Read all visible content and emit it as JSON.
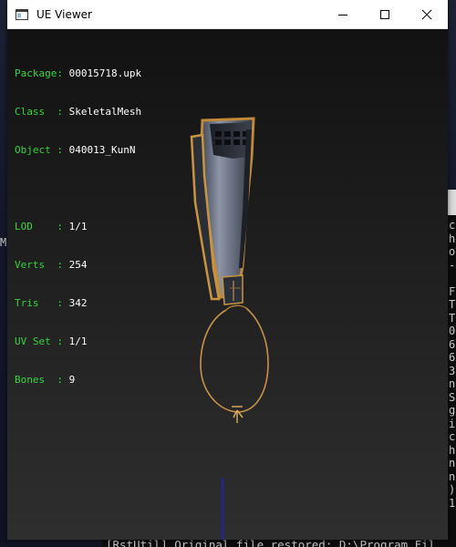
{
  "window": {
    "title": "UE Viewer"
  },
  "info": {
    "package": {
      "label": "Package:",
      "value": "00015718.upk"
    },
    "class": {
      "label": "Class  :",
      "value": "SkeletalMesh"
    },
    "object": {
      "label": "Object :",
      "value": "040013_KunN"
    },
    "lod": {
      "label": "LOD    :",
      "value": "1/1"
    },
    "verts": {
      "label": "Verts  :",
      "value": "254"
    },
    "tris": {
      "label": "Tris   :",
      "value": "342"
    },
    "uvset": {
      "label": "UV Set :",
      "value": "1/1"
    },
    "bones": {
      "label": "Bones  :",
      "value": "9"
    }
  },
  "colors": {
    "label_green": "#33d63a",
    "value_white": "#ffffff",
    "axis_blue": "#1a1aff"
  },
  "console": {
    "right_lines": [
      "c",
      "h",
      "o",
      "-",
      "",
      "F",
      "T",
      "T",
      "0",
      "6",
      "6",
      "3",
      "n",
      "S",
      "g",
      "i",
      "c",
      "h",
      "n",
      "n",
      ")",
      "1"
    ],
    "left_fragment": "M",
    "bottom_text": "[RstUtil] Original file restored: D:\\Program Fil"
  },
  "icons": {
    "app": "app-window-icon",
    "minimize": "minimize-icon",
    "maximize": "maximize-icon",
    "close": "close-icon"
  }
}
